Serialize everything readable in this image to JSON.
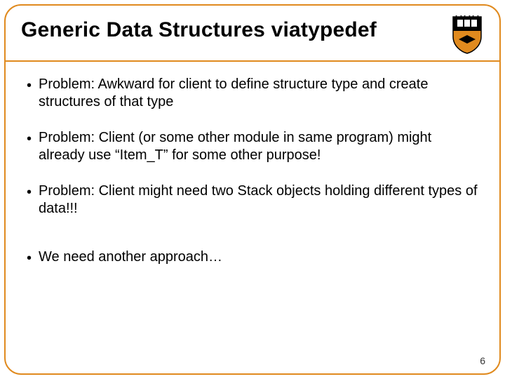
{
  "slide": {
    "title": "Generic Data Structures viatypedef",
    "bullets": [
      "Problem: Awkward for client to define structure type and create structures of that type",
      "Problem: Client (or some other module in same program) might already use “Item_T” for some other purpose!",
      "Problem: Client might need two Stack objects holding different types of data!!!",
      "We need another approach…"
    ],
    "page_number": "6",
    "bullet_char": "•"
  }
}
